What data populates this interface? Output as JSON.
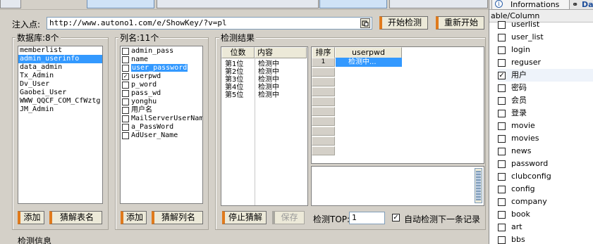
{
  "inject": {
    "label": "注入点:",
    "url": "http://www.autono1.com/e/ShowKey/?v=pl"
  },
  "toolbar": {
    "start_check": "开始检测",
    "reset": "重新开始"
  },
  "db": {
    "title": "数据库:8个",
    "items": [
      "memberlist",
      "admin_userinfo",
      "data_admin",
      "Tx_Admin",
      "Dv_User",
      "Gaobei_User",
      "WWW_QQCF_COM_CfWztg",
      "JM_Admin"
    ],
    "add": "添加",
    "crack_tables": "猜解表名"
  },
  "cols": {
    "title": "列名:11个",
    "items": [
      "admin_pass",
      "name",
      "user_password",
      "userpwd",
      "p_word",
      "pass_wd",
      "yonghu",
      "用户名",
      "MailServerUserNam",
      "a_PassWord",
      "AdUser_Name"
    ],
    "add": "添加",
    "crack_cols": "猜解列名"
  },
  "result": {
    "title": "检测结果",
    "headers": [
      "位数",
      "内容"
    ],
    "rows": [
      [
        "第1位",
        "检测中"
      ],
      [
        "第2位",
        "检测中"
      ],
      [
        "第3位",
        "检测中"
      ],
      [
        "第4位",
        "检测中"
      ],
      [
        "第5位",
        "检测中"
      ]
    ],
    "stop": "停止猜解",
    "save": "保存",
    "top_label": "检测TOP:",
    "top_value": "1",
    "auto_next": "自动检测下一条记录"
  },
  "grid2": {
    "headers": [
      "排序",
      "userpwd"
    ],
    "row": {
      "num": "1",
      "value": "检测中..."
    }
  },
  "info": {
    "title": "检测信息"
  },
  "right": {
    "tab_label": "Informations",
    "tab2_label": "Da",
    "header": "able/Column",
    "items": [
      {
        "label": "userlist",
        "checked": false
      },
      {
        "label": "user_list",
        "checked": false
      },
      {
        "label": "login",
        "checked": false
      },
      {
        "label": "reguser",
        "checked": false
      },
      {
        "label": "用户",
        "checked": true
      },
      {
        "label": "密码",
        "checked": false
      },
      {
        "label": "会员",
        "checked": false
      },
      {
        "label": "登录",
        "checked": false
      },
      {
        "label": "movie",
        "checked": false
      },
      {
        "label": "movies",
        "checked": false
      },
      {
        "label": "news",
        "checked": false
      },
      {
        "label": "password",
        "checked": false
      },
      {
        "label": "clubconfig",
        "checked": false
      },
      {
        "label": "config",
        "checked": false
      },
      {
        "label": "company",
        "checked": false
      },
      {
        "label": "book",
        "checked": false
      },
      {
        "label": "art",
        "checked": false
      },
      {
        "label": "bbs",
        "checked": false
      }
    ]
  }
}
